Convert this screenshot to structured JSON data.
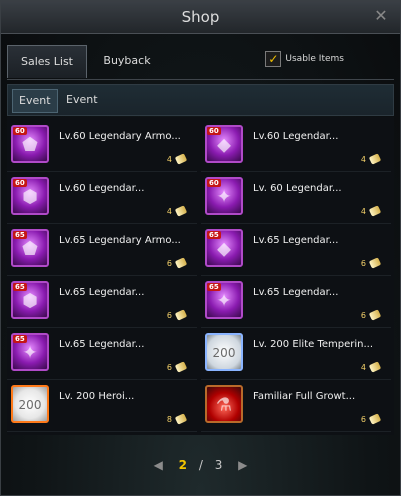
{
  "window": {
    "title": "Shop"
  },
  "tabs": [
    {
      "label": "Sales List"
    },
    {
      "label": "Buyback"
    }
  ],
  "usable_items": {
    "label": "Usable Items",
    "checked": true
  },
  "subtabs": [
    {
      "label": "Event"
    },
    {
      "label": "Event"
    }
  ],
  "items": [
    {
      "badge": "60",
      "name": "Lv.60 Legendary Armo...",
      "price": "4",
      "style": "purple",
      "icon": "shield-icon"
    },
    {
      "badge": "60",
      "name": "Lv.60 Legendar...",
      "price": "4",
      "style": "purple",
      "icon": "gem-icon"
    },
    {
      "badge": "60",
      "name": "Lv.60 Legendar...",
      "price": "4",
      "style": "purple",
      "icon": "armor-icon"
    },
    {
      "badge": "60",
      "name": "Lv. 60 Legendar...",
      "price": "4",
      "style": "purple",
      "icon": "amulet-icon"
    },
    {
      "badge": "65",
      "name": "Lv.65 Legendary Armo...",
      "price": "6",
      "style": "purple",
      "icon": "shield-icon"
    },
    {
      "badge": "65",
      "name": "Lv.65 Legendar...",
      "price": "6",
      "style": "purple",
      "icon": "gem-icon"
    },
    {
      "badge": "65",
      "name": "Lv.65 Legendar...",
      "price": "6",
      "style": "purple",
      "icon": "armor-icon"
    },
    {
      "badge": "65",
      "name": "Lv.65 Legendar...",
      "price": "6",
      "style": "purple",
      "icon": "amulet-icon"
    },
    {
      "badge": "65",
      "name": "Lv.65 Legendar...",
      "price": "6",
      "style": "purple",
      "icon": "amulet-icon"
    },
    {
      "badge": "",
      "name": "Lv. 200 Elite Temperin...",
      "price": "4",
      "style": "white",
      "icon": "ticket-icon"
    },
    {
      "badge": "",
      "name": "Lv. 200 Heroi...",
      "price": "8",
      "style": "orange",
      "icon": "ticket-icon"
    },
    {
      "badge": "",
      "name": "Familiar Full Growt...",
      "price": "6",
      "style": "red",
      "icon": "potion-icon"
    }
  ],
  "pagination": {
    "current": "2",
    "separator": "/",
    "total": "3"
  },
  "colors": {
    "accent": "#f2c400",
    "legendary": "#b04ac8"
  }
}
